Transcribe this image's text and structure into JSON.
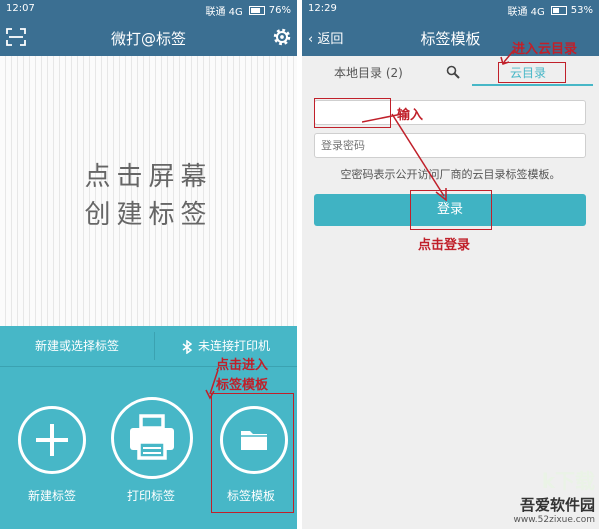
{
  "left": {
    "status": {
      "time": "12:07",
      "network": "联通 4G",
      "battery": "76%",
      "battery_level": 0.76
    },
    "header": {
      "title": "微打@标签"
    },
    "canvas": {
      "hint_line1": "点击屏幕",
      "hint_line2": "创建标签"
    },
    "bottom": {
      "new_or_select": "新建或选择标签",
      "printer_status": "未连接打印机",
      "buttons": [
        {
          "label": "新建标签",
          "icon": "plus-icon"
        },
        {
          "label": "打印标签",
          "icon": "printer-icon"
        },
        {
          "label": "标签模板",
          "icon": "folder-icon"
        }
      ]
    },
    "annotation": {
      "line1": "点击进入",
      "line2": "标签模板"
    }
  },
  "right": {
    "status": {
      "time": "12:29",
      "network": "联通 4G",
      "battery": "53%",
      "battery_level": 0.53
    },
    "header": {
      "back": "返回",
      "title": "标签模板"
    },
    "tabs": {
      "local": "本地目录 (2)",
      "cloud": "云目录"
    },
    "form": {
      "account_value": "",
      "password_placeholder": "登录密码",
      "helper": "空密码表示公开访问厂商的云目录标签模板。",
      "login": "登录"
    },
    "annotations": {
      "enter_cloud": "进入云目录",
      "input": "输入",
      "click_login": "点击登录"
    }
  },
  "watermark": {
    "big": "k下载",
    "name": "吾爱软件园",
    "url": "www.52zixue.com"
  },
  "colors": {
    "header": "#3b6f92",
    "accent": "#47b7c7",
    "annotation": "#c0202a"
  }
}
